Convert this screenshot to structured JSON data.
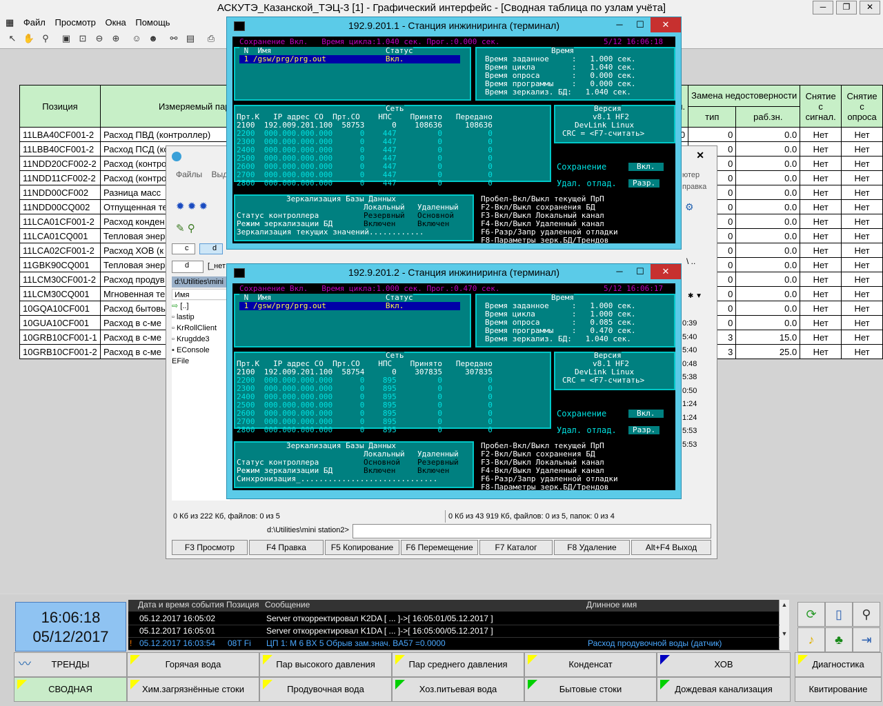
{
  "app": {
    "title": "АСКУТЭ_Казанской_ТЭЦ-3 [1] - Графический интерфейс - [Сводная таблица по узлам учёта]",
    "menu": [
      "Файл",
      "Просмотр",
      "Окна",
      "Помощь"
    ]
  },
  "table": {
    "headers": {
      "position": "Позиция",
      "param": "Измеряемый пар",
      "partial": "ин.",
      "replace": "Замена недостоверности",
      "type": "тип",
      "workval": "раб.зн.",
      "remove_signal": "Снятие с сигнал.",
      "remove_poll": "Снятие с опроса"
    },
    "rows": [
      {
        "pos": "11LBA40CF001-2",
        "param": "Расход ПВД (контроллер)",
        "partial": "0.0",
        "type": "0",
        "val": "0.0",
        "sig": "Нет",
        "poll": "Нет"
      },
      {
        "pos": "11LBB40CF001-2",
        "param": "Расход ПСД (контроллер)",
        "partial": "",
        "type": "0",
        "val": "0.0",
        "sig": "Нет",
        "poll": "Нет"
      },
      {
        "pos": "11NDD20CF002-2",
        "param": "Расход (контро",
        "partial": "",
        "type": "0",
        "val": "0.0",
        "sig": "Нет",
        "poll": "Нет"
      },
      {
        "pos": "11NDD11CF002-2",
        "param": "Расход (контро",
        "partial": "",
        "type": "0",
        "val": "0.0",
        "sig": "Нет",
        "poll": "Нет"
      },
      {
        "pos": "11NDD00CF002",
        "param": "Разница масс",
        "partial": "",
        "type": "0",
        "val": "0.0",
        "sig": "Нет",
        "poll": "Нет"
      },
      {
        "pos": "11NDD00CQ002",
        "param": "Отпущенная те",
        "partial": "",
        "type": "0",
        "val": "0.0",
        "sig": "Нет",
        "poll": "Нет"
      },
      {
        "pos": "11LCA01CF001-2",
        "param": "Расход конден",
        "partial": "",
        "type": "0",
        "val": "0.0",
        "sig": "Нет",
        "poll": "Нет"
      },
      {
        "pos": "11LCA01CQ001",
        "param": "Тепловая энер",
        "partial": "",
        "type": "0",
        "val": "0.0",
        "sig": "Нет",
        "poll": "Нет"
      },
      {
        "pos": "11LCA02CF001-2",
        "param": "Расход ХОВ (к",
        "partial": "",
        "type": "0",
        "val": "0.0",
        "sig": "Нет",
        "poll": "Нет"
      },
      {
        "pos": "11GBK90CQ001",
        "param": "Тепловая энер",
        "partial": "",
        "type": "0",
        "val": "0.0",
        "sig": "Нет",
        "poll": "Нет"
      },
      {
        "pos": "11LCM30CF001-2",
        "param": "Расход продув",
        "partial": "",
        "type": "0",
        "val": "0.0",
        "sig": "Нет",
        "poll": "Нет"
      },
      {
        "pos": "11LCM30CQ001",
        "param": "Мгновенная те",
        "partial": "",
        "type": "0",
        "val": "0.0",
        "sig": "Нет",
        "poll": "Нет"
      },
      {
        "pos": "10GQA10CF001",
        "param": "Расход бытовы",
        "partial": "",
        "type": "0",
        "val": "0.0",
        "sig": "Нет",
        "poll": "Нет"
      },
      {
        "pos": "10GUA10CF001",
        "param": "Расход в с-ме",
        "partial": "",
        "type": "0",
        "val": "0.0",
        "sig": "Нет",
        "poll": "Нет"
      },
      {
        "pos": "10GRB10CF001-1",
        "param": "Расход в с-ме",
        "partial": "",
        "type": "3",
        "val": "15.0",
        "sig": "Нет",
        "poll": "Нет"
      },
      {
        "pos": "10GRB10CF001-2",
        "param": "Расход в с-ме",
        "partial": "",
        "type": "3",
        "val": "25.0",
        "sig": "Нет",
        "poll": "Нет"
      }
    ]
  },
  "fm": {
    "menu": [
      "Файлы",
      "Выд"
    ],
    "right_menu": [
      "ютер",
      "правка"
    ],
    "drive_c": "c",
    "drive_d": "d",
    "drive_sel": "d",
    "drive_info": "[_нет",
    "path": "d:\\Utilities\\mini",
    "col_name": "Имя",
    "files": [
      "[..]",
      "lastip",
      "KrRollClient",
      "Krugdde3",
      "EConsole",
      "EFile"
    ],
    "right_times": [
      "0:39",
      "5:40",
      "5:40",
      "0:48",
      "5:38",
      "0:50",
      "1:24",
      "1:24",
      "5:53",
      "5:53"
    ],
    "status_left": "0 Кб из 222 Кб, файлов: 0 из 5",
    "status_right": "0 Кб из 43 919 Кб, файлов: 0 из 5, папок: 0 из 4",
    "cmd_label": "d:\\Utilities\\mini station2>",
    "cmd_value": "",
    "buttons": [
      "F3 Просмотр",
      "F4 Правка",
      "F5 Копирование",
      "F6 Перемещение",
      "F7 Каталог",
      "F8 Удаление",
      "Alt+F4 Выход"
    ]
  },
  "term1": {
    "title": "192.9.201.1 - Станция инжиниринга (терминал)",
    "top": "Сохранение Вкл.   Время цикла:1.040 сек. Прог.:0.000 сек.",
    "datetime": "5/12 16:06:18",
    "prog_header": " N  Имя                         Статус",
    "prog_row": " 1 /gsw/prg/prg.out             Вкл.",
    "time_title": "Время",
    "times": [
      "Время заданное     :   1.000 сек.",
      "Время цикла        :   1.040 сек.",
      "Время опроса       :   0.000 сек.",
      "Время программы    :   0.000 сек.",
      "Время зеркализ. БД:   1.040 сек."
    ],
    "net_title": "Сеть",
    "net_header": "Прт.К   IP адрес СО  Прт.СО    НПС    Принято   Передано",
    "net_rows": [
      "2100  192.009.201.100  58753      0    108636     108636",
      "2200  000.000.000.000      0    447         0          0",
      "2300  000.000.000.000      0    447         0          0",
      "2400  000.000.000.000      0    447         0          0",
      "2500  000.000.000.000      0    447         0          0",
      "2600  000.000.000.000      0    447         0          0",
      "2700  000.000.000.000      0    447         0          0",
      "2800  000.000.000.000      0    447         0          0"
    ],
    "ver_title": "Версия",
    "ver": [
      "v8.1 HF2",
      "DevLink Linux",
      "CRC = <F7-считать>"
    ],
    "save_label": "Сохранение",
    "save_val": "Вкл.",
    "dbg_label": "Удал. отлад.",
    "dbg_val": "Разр.",
    "mir_title": "Зеркализация Базы Данных",
    "mir_cols": [
      "Локальный",
      "Удаленный"
    ],
    "mir_status_label": "Статус контроллера",
    "mir_status": [
      "Резервный",
      "Основной"
    ],
    "mir_mode_label": "Режим зеркализации БД",
    "mir_mode": [
      "Включен",
      "Включен"
    ],
    "mir_bottom": "Зеркализация текущих значений............",
    "keys": [
      "Пробел-Вкл/Выкл текущей ПрП",
      "F2-Вкл/Выкл сохранения БД",
      "F3-Вкл/Выкл Локальный канал",
      "F4-Вкл/Выкл Удаленный канал",
      "F6-Разр/Запр удаленной отладки",
      "F8-Параметры зерк.БД/Трендов"
    ]
  },
  "term2": {
    "title": "192.9.201.2 - Станция инжиниринга (терминал)",
    "top": "Сохранение Вкл.   Время цикла:1.000 сек. Прог.:0.470 сек.",
    "datetime": "5/12 16:06:17",
    "prog_header": " N  Имя                         Статус",
    "prog_row": " 1 /gsw/prg/prg.out             Вкл.",
    "time_title": "Время",
    "times": [
      "Время заданное     :   1.000 сек.",
      "Время цикла        :   1.000 сек.",
      "Время опроса       :   0.085 сек.",
      "Время программы    :   0.470 сек.",
      "Время зеркализ. БД:   1.040 сек."
    ],
    "net_title": "Сеть",
    "net_header": "Прт.К   IP адрес СО  Прт.СО    НПС    Принято   Передано",
    "net_rows": [
      "2100  192.009.201.100  58754      0    307835     307835",
      "2200  000.000.000.000      0    895         0          0",
      "2300  000.000.000.000      0    895         0          0",
      "2400  000.000.000.000      0    895         0          0",
      "2500  000.000.000.000      0    895         0          0",
      "2600  000.000.000.000      0    895         0          0",
      "2700  000.000.000.000      0    895         0          0",
      "2800  000.000.000.000      0    895         0          0"
    ],
    "ver_title": "Версия",
    "ver": [
      "v8.1 HF2",
      "DevLink Linux",
      "CRC = <F7-считать>"
    ],
    "save_label": "Сохранение",
    "save_val": "Вкл.",
    "dbg_label": "Удал. отлад.",
    "dbg_val": "Разр.",
    "mir_title": "Зеркализация Базы Данных",
    "mir_cols": [
      "Локальный",
      "Удаленный"
    ],
    "mir_status_label": "Статус контроллера",
    "mir_status": [
      "Основной",
      "Резервный"
    ],
    "mir_mode_label": "Режим зеркализации БД",
    "mir_mode": [
      "Включен",
      "Включен"
    ],
    "mir_bottom": "Синхронизация_..............................",
    "keys": [
      "Пробел-Вкл/Выкл текущей ПрП",
      "F2-Вкл/Выкл сохранения БД",
      "F3-Вкл/Выкл Локальный канал",
      "F4-Вкл/Выкл Удаленный канал",
      "F6-Разр/Запр удаленной отладки",
      "F8-Параметры зерк.БД/Трендов"
    ]
  },
  "clock": {
    "time": "16:06:18",
    "date": "05/12/2017"
  },
  "events": {
    "headers": [
      "Дата и время события",
      "Позиция",
      "Сообщение",
      "Длинное имя"
    ],
    "rows": [
      {
        "dt": "05.12.2017 16:05:02",
        "pos": "",
        "msg": "Server откорректировал K2DA [ ... ]->[ 16:05:01/05.12.2017 ]",
        "name": ""
      },
      {
        "dt": "05.12.2017 16:05:01",
        "pos": "",
        "msg": "Server откорректировал K1DA [ ... ]->[ 16:05:00/05.12.2017 ]",
        "name": ""
      },
      {
        "dt": "05.12.2017 16:03:54",
        "pos": "08T Fi",
        "msg": "ЦП 1: M  6 BX 5 Обрыв  зам.знач. BA57 =0.0000",
        "name": "Расход продувочной воды (датчик)"
      }
    ]
  },
  "nav": {
    "row1": [
      "ТРЕНДЫ",
      "Горячая вода",
      "Пар высокого давления",
      "Пар среднего давления",
      "Конденсат",
      "ХОВ",
      "Диагностика"
    ],
    "row2": [
      "СВОДНАЯ",
      "Хим.загрязнённые стоки",
      "Продувочная вода",
      "Хоз.питьевая вода",
      "Бытовые стоки",
      "Дождевая канализация",
      "Квитирование"
    ]
  },
  "colors": {
    "accent": "#5bcbe8",
    "alarm": "#c7302f",
    "header_green": "#c7efc7"
  }
}
